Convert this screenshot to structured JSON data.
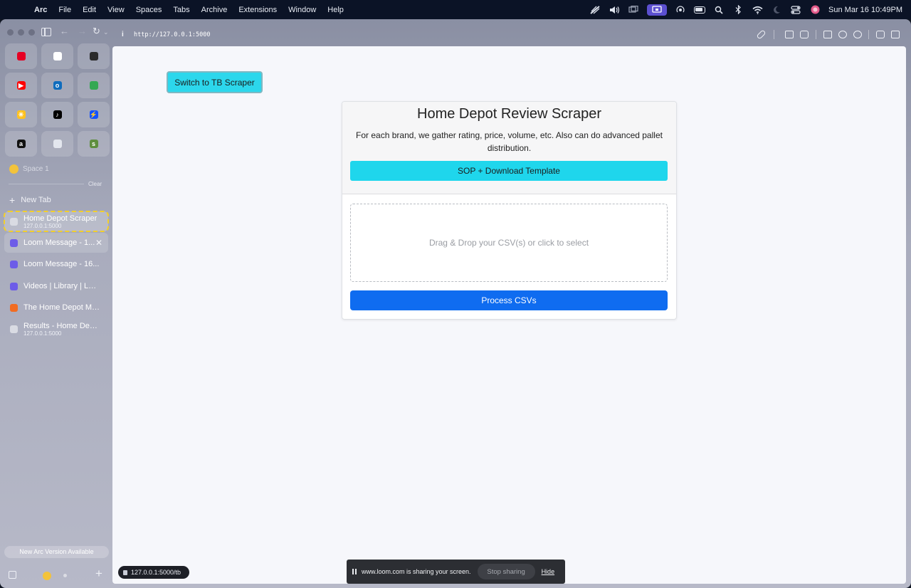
{
  "menubar": {
    "apple": "",
    "items": [
      "Arc",
      "File",
      "Edit",
      "View",
      "Spaces",
      "Tabs",
      "Archive",
      "Extensions",
      "Window",
      "Help"
    ],
    "status_icons": [
      "screen-mirror-icon",
      "volume-icon",
      "stage-manager-icon",
      "screen-share-icon",
      "airdrop-icon",
      "battery-icon",
      "spotlight-icon",
      "bluetooth-icon",
      "wifi-icon",
      "focus-icon",
      "control-center-icon",
      "siri-icon"
    ],
    "clock": "Sun Mar 16  10:49PM"
  },
  "toolbar": {
    "site_info_label": "i",
    "url": "http://127.0.0.1:5000"
  },
  "sidebar": {
    "favorites": [
      {
        "name": "pinterest-favicon",
        "color": "#e60023",
        "glyph": ""
      },
      {
        "name": "openai-favicon",
        "color": "#ffffff",
        "glyph": ""
      },
      {
        "name": "notion-favicon",
        "color": "#2b2b2b",
        "glyph": ""
      },
      {
        "name": "youtube-favicon",
        "color": "#ff0000",
        "glyph": "▶"
      },
      {
        "name": "outlook-favicon",
        "color": "#0f6cbd",
        "glyph": "o"
      },
      {
        "name": "google-drive-favicon",
        "color": "#34a853",
        "glyph": ""
      },
      {
        "name": "walmart-favicon",
        "color": "#ffc220",
        "glyph": "✳"
      },
      {
        "name": "tiktok-favicon",
        "color": "#000000",
        "glyph": "♪"
      },
      {
        "name": "shortcut-favicon",
        "color": "#1452ff",
        "glyph": "⚡"
      },
      {
        "name": "amazon-favicon",
        "color": "#111111",
        "glyph": "a"
      },
      {
        "name": "cloud-favicon",
        "color": "#e3e6ee",
        "glyph": ""
      },
      {
        "name": "shopify-favicon",
        "color": "#5e8e3e",
        "glyph": "s"
      }
    ],
    "space_label": "Space 1",
    "clear_label": "Clear",
    "new_tab_label": "New Tab",
    "tabs": [
      {
        "title": "Home Depot Scraper",
        "subtitle": "127.0.0.1:5000",
        "icon_color": "#d9dbe3"
      },
      {
        "title": "Loom Message - 1...",
        "close": "✕",
        "icon_color": "#6d5ce8"
      },
      {
        "title": "Loom Message - 16...",
        "icon_color": "#6d5ce8"
      },
      {
        "title": "Videos | Library | Loom",
        "icon_color": "#6d5ce8"
      },
      {
        "title": "The Home Depot Mar...",
        "icon_color": "#f26c22"
      },
      {
        "title": "Results - Home Depo...",
        "subtitle": "127.0.0.1:5000",
        "icon_color": "#d9dbe3"
      }
    ],
    "update_label": "New Arc Version Available"
  },
  "page": {
    "switch_button": "Switch to TB Scraper",
    "card": {
      "title": "Home Depot Review Scraper",
      "description": "For each brand, we gather rating, price, volume, etc. Also can do advanced pallet distribution.",
      "sop_button": "SOP + Download Template",
      "dropzone_text": "Drag & Drop your CSV(s) or click to select",
      "process_button": "Process CSVs"
    }
  },
  "status_url": "127.0.0.1:5000/tb",
  "share_bar": {
    "text": "www.loom.com is sharing your screen.",
    "stop_label": "Stop sharing",
    "hide_label": "Hide"
  }
}
